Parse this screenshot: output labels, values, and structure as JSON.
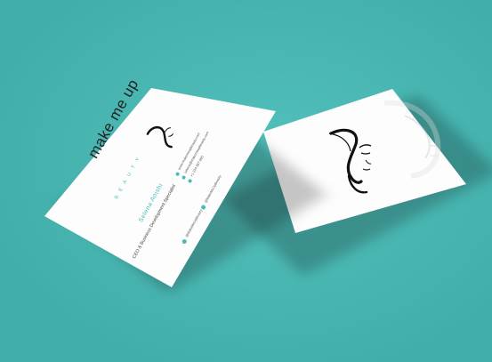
{
  "scene": {
    "background_color": "#47bcb7",
    "accent_color": "#47bcb7"
  },
  "front_card": {
    "logo_main": "make me up",
    "logo_sub": "BEAUTY",
    "name": "Selena Anishi",
    "job_title": "CEO & Business Development Specialist",
    "contacts": [
      {
        "icon": "globe-icon",
        "text": "www.makemeupbeauty.com"
      },
      {
        "icon": "mail-icon",
        "text": "selena@makemeupbeauty.com"
      },
      {
        "icon": "phone-icon",
        "text": "+1 234 567 890"
      }
    ],
    "socials": [
      {
        "icon": "facebook-icon",
        "text": "@MakeMeUpBeauty"
      },
      {
        "icon": "instagram-icon",
        "text": "@MakeMeUpBeauty"
      },
      {
        "icon": "twitter-icon",
        "text": "@MakeMeUpBeauty"
      }
    ]
  },
  "back_card": {
    "emblem": "face-line-art-icon"
  }
}
